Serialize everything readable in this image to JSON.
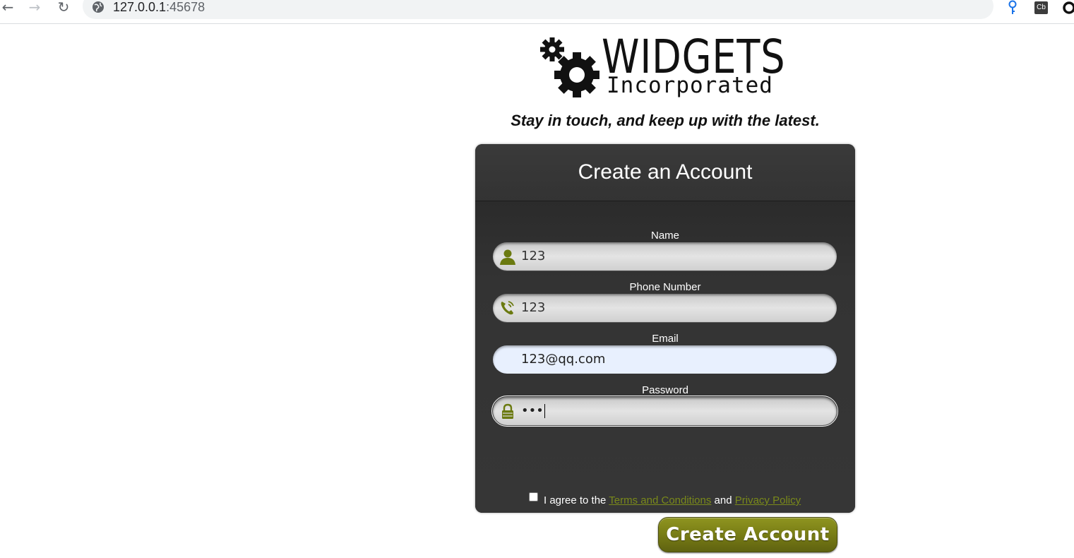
{
  "browser": {
    "url_host": "127.0.0.1",
    "url_port": ":45678",
    "extension_cb_label": "Cb"
  },
  "logo": {
    "word": "WIDGETS",
    "sub": "Incorporated"
  },
  "tagline": "Stay in touch, and keep up with the latest.",
  "form": {
    "title": "Create an Account",
    "fields": [
      {
        "label": "Name",
        "value": "123",
        "icon": "person-icon"
      },
      {
        "label": "Phone Number",
        "value": "123",
        "icon": "phone-icon"
      },
      {
        "label": "Email",
        "value": "123@qq.com",
        "icon": "none"
      },
      {
        "label": "Password",
        "value": "•••",
        "icon": "lock-icon"
      }
    ],
    "agree_prefix": "I agree to the ",
    "terms_link": "Terms and Conditions",
    "agree_and": " and ",
    "privacy_link": "Privacy Policy",
    "agree_checked": false,
    "submit_label": "Create Account"
  },
  "colors": {
    "card": "#333333",
    "accent_olive": "#7a7f16",
    "link": "#7a8a1a",
    "icon_olive": "#6b7a10"
  }
}
